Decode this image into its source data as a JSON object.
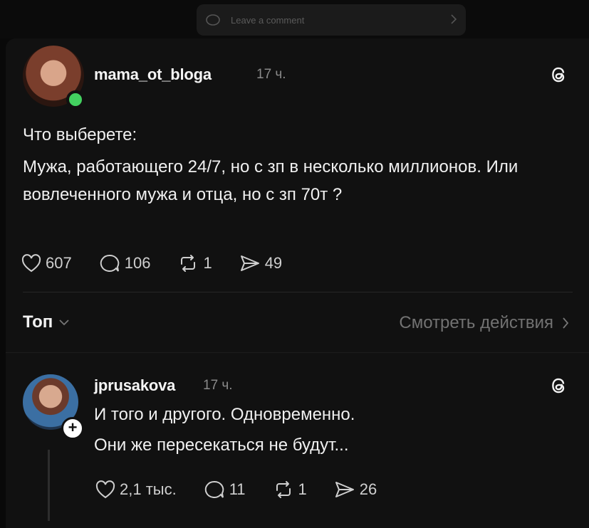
{
  "top_bar": {
    "leave_comment": "Leave a comment"
  },
  "post": {
    "username": "mama_ot_bloga",
    "time": "17 ч.",
    "question": "Что выберете:",
    "body": "Мужа, работающего 24/7, но с зп в несколько миллионов. Или вовлеченного мужа и отца, но с зп 70т ?",
    "likes": "607",
    "comments": "106",
    "reposts": "1",
    "shares": "49"
  },
  "sort": {
    "label": "Топ",
    "view_activity": "Смотреть действия"
  },
  "reply": {
    "username": "jprusakova",
    "time": "17 ч.",
    "line1": "И того и другого. Одновременно.",
    "line2": "Они же пересекаться не будут...",
    "likes": "2,1 тыс.",
    "comments": "11",
    "reposts": "1",
    "shares": "26"
  },
  "colors": {
    "background": "#111111",
    "online": "#43d160",
    "muted_text": "#8a8a8a"
  },
  "icons": [
    "chat-bubble-icon",
    "chevron-right-icon",
    "threads-logo-icon",
    "heart-icon",
    "comment-icon",
    "repost-icon",
    "share-icon",
    "chevron-down-icon",
    "plus-icon"
  ]
}
